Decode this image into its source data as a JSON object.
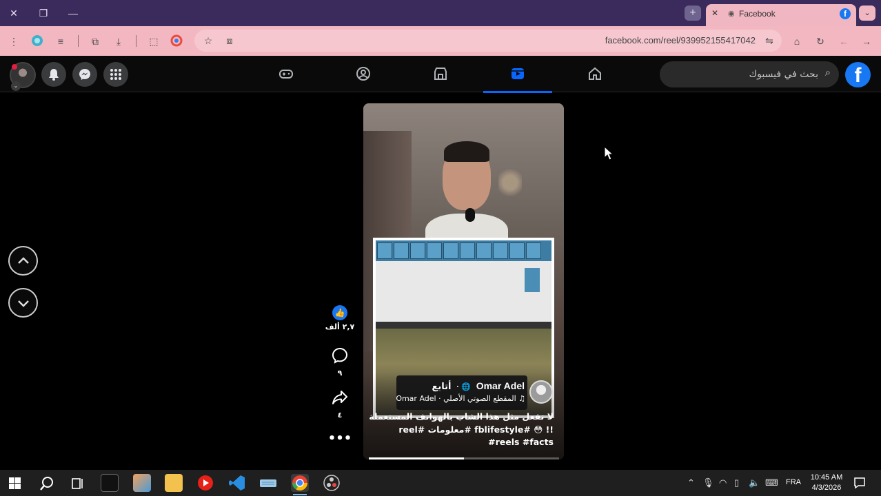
{
  "browser": {
    "tab_title": "Facebook",
    "url": "facebook.com/reel/939952155417042"
  },
  "facebook": {
    "search_placeholder": "بحث في فيسبوك",
    "logo_letter": "f",
    "nav_tabs": [
      "home",
      "reels",
      "marketplace",
      "groups",
      "gaming"
    ],
    "active_tab": "reels"
  },
  "reel": {
    "author": "Omar Adel",
    "follow_label": "أتابع",
    "audio": "المقطع الصوتي الأصلي · Omar Adel",
    "caption": "لا تفعل مثل هذا الشاب بالهواتف المستعملة !! 😳 #fblifestyle #معلومات #reel #reels #facts",
    "likes": "٢,٧ ألف",
    "comments": "٩",
    "shares": "٤",
    "progress_fraction": 0.5
  },
  "taskbar": {
    "lang": "FRA",
    "time": "10:45 AM",
    "date": "4/3/2026"
  },
  "colors": {
    "titlebar": "#3b2a5c",
    "toolbar": "#f3b7c2",
    "fb_blue": "#1877f2",
    "active_underline": "#0866ff"
  }
}
